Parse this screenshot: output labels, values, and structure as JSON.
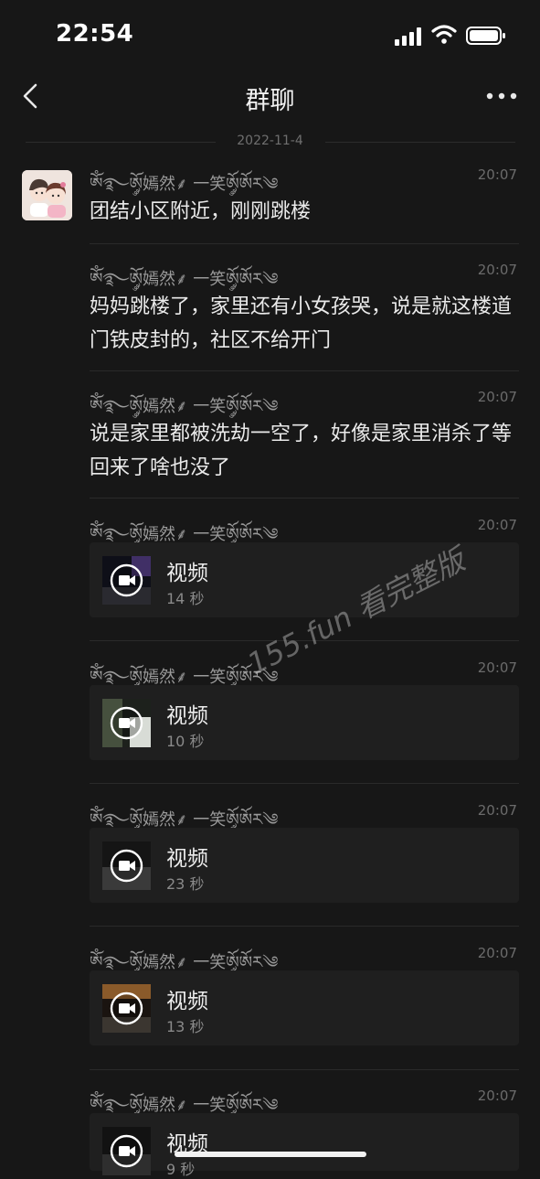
{
  "status_bar": {
    "time": "22:54"
  },
  "nav": {
    "title": "群聊"
  },
  "date_separator": "2022-11-4",
  "messages": [
    {
      "sender": "ༀ࿐ཨོ༘嫣然⸙ 一笑ཨོ༘ཨོར༄",
      "time": "20:07",
      "text": "团结小区附近，刚刚跳楼"
    },
    {
      "sender": "ༀ࿐ཨོ༘嫣然⸙ 一笑ཨོ༘ཨོར༄",
      "time": "20:07",
      "text": "妈妈跳楼了，家里还有小女孩哭，说是就这楼道门铁皮封的，社区不给开门"
    },
    {
      "sender": "ༀ࿐ཨོ༘嫣然⸙ 一笑ཨོ༘ཨོར༄",
      "time": "20:07",
      "text": "说是家里都被洗劫一空了，好像是家里消杀了等回来了啥也没了"
    }
  ],
  "videos": [
    {
      "sender": "ༀ࿐ཨོ༘嫣然⸙ 一笑ཨོ༘ཨོར༄",
      "time": "20:07",
      "label": "视频",
      "duration": "14 秒"
    },
    {
      "sender": "ༀ࿐ཨོ༘嫣然⸙ 一笑ཨོ༘ཨོར༄",
      "time": "20:07",
      "label": "视频",
      "duration": "10 秒"
    },
    {
      "sender": "ༀ࿐ཨོ༘嫣然⸙ 一笑ཨོ༘ཨོར༄",
      "time": "20:07",
      "label": "视频",
      "duration": "23 秒"
    },
    {
      "sender": "ༀ࿐ཨོ༘嫣然⸙ 一笑ཨོ༘ཨོར༄",
      "time": "20:07",
      "label": "视频",
      "duration": "13 秒"
    },
    {
      "sender": "ༀ࿐ཨོ༘嫣然⸙ 一笑ཨོ༘ཨོར༄",
      "time": "20:07",
      "label": "视频",
      "duration": "9 秒"
    }
  ],
  "watermark": "155.fun 看完整版",
  "icons": {
    "back": "chevron-left-icon",
    "more": "more-dots-icon",
    "play": "video-play-icon",
    "signal": "signal-icon",
    "wifi": "wifi-icon",
    "battery": "battery-icon"
  },
  "colors": {
    "background": "#171717",
    "card": "#1f1f1f",
    "text": "#eaeaea",
    "meta": "#6b6b6b"
  }
}
